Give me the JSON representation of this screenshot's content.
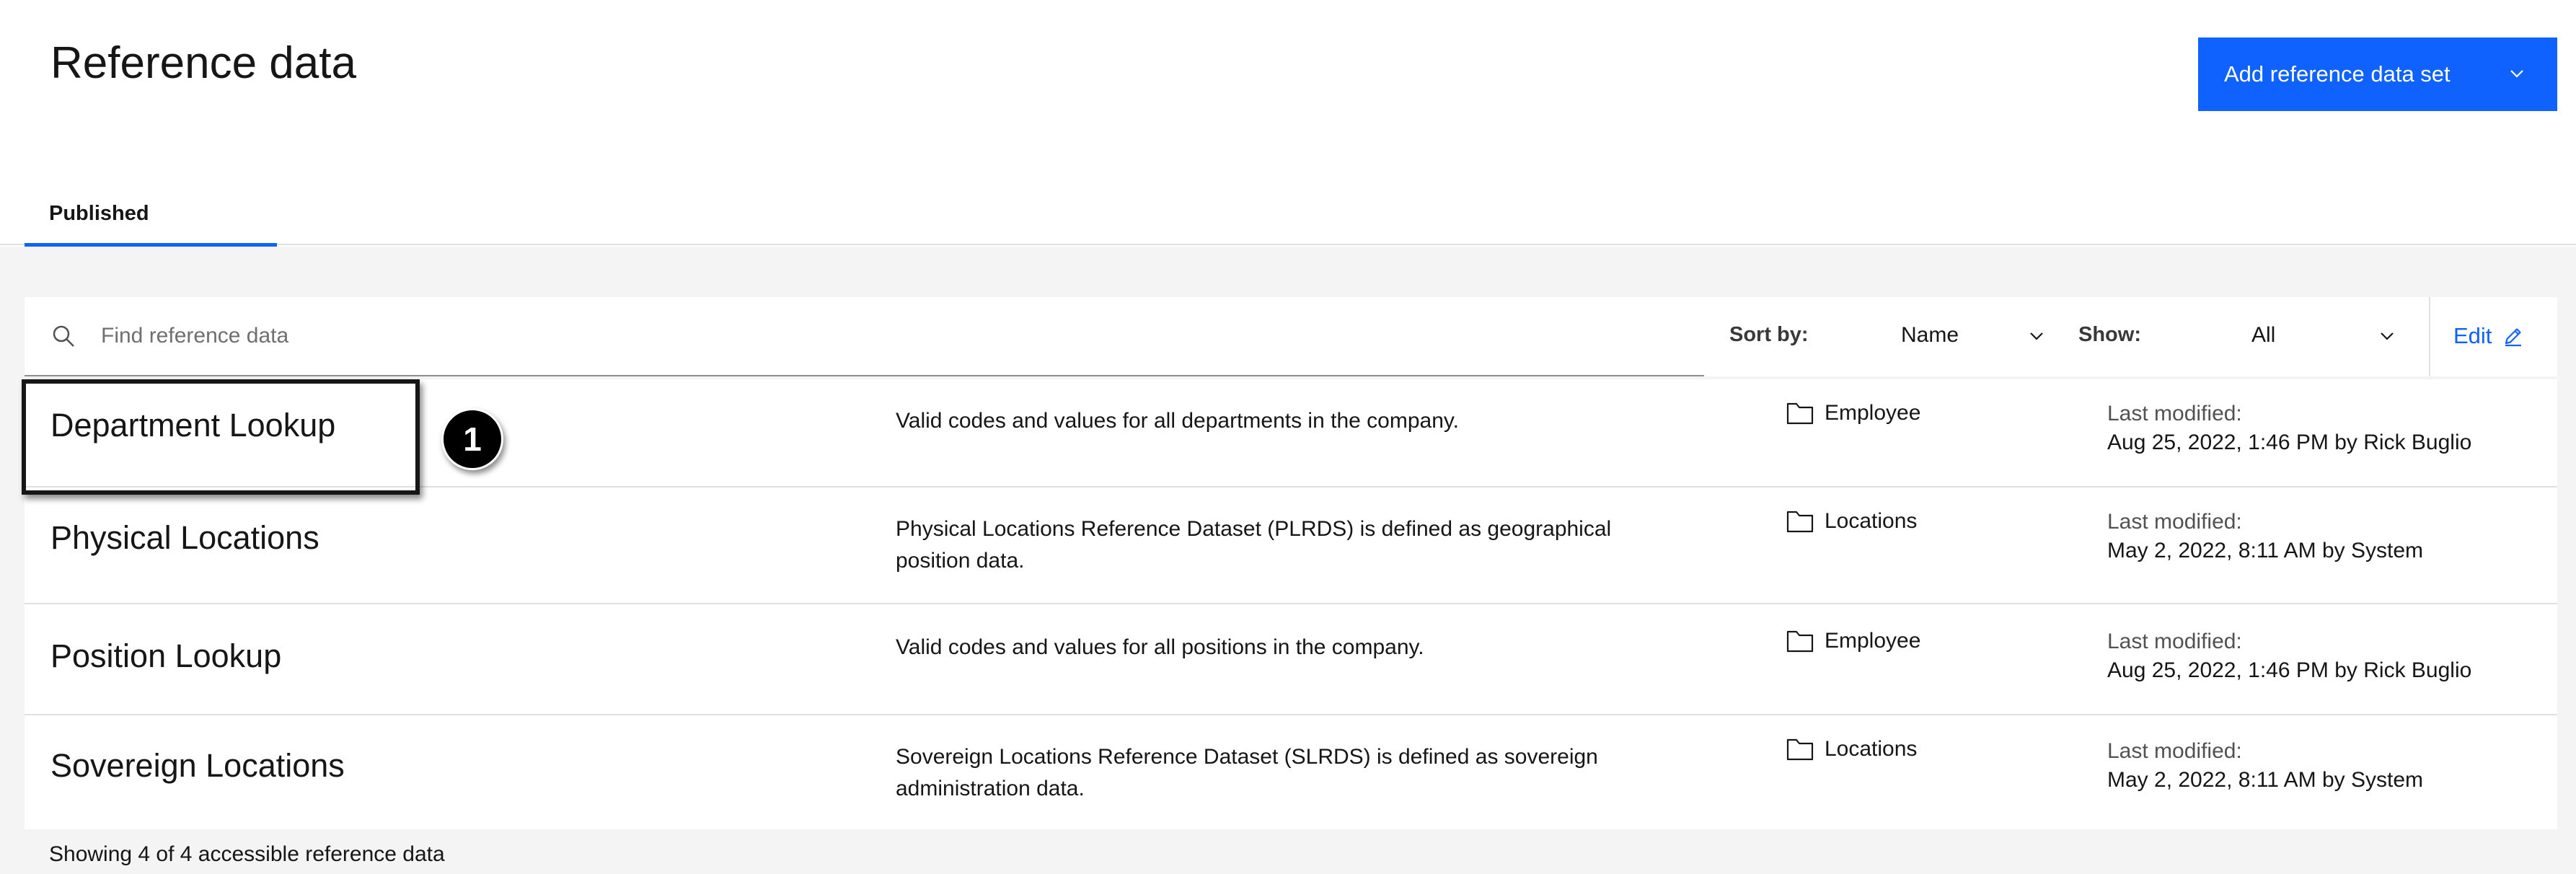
{
  "header": {
    "title": "Reference data",
    "add_button_label": "Add reference data set"
  },
  "tabs": [
    {
      "label": "Published",
      "selected": true
    }
  ],
  "toolbar": {
    "search_placeholder": "Find reference data",
    "search_value": "",
    "sort_label": "Sort by:",
    "sort_value": "Name",
    "show_label": "Show:",
    "show_value": "All",
    "edit_label": "Edit"
  },
  "rows": [
    {
      "name": "Department Lookup",
      "description": "Valid codes and values for all departments in the company.",
      "folder": "Employee",
      "modified_label": "Last modified:",
      "modified_value": "Aug 25, 2022, 1:46 PM by Rick Buglio"
    },
    {
      "name": "Physical Locations",
      "description": "Physical Locations Reference Dataset (PLRDS) is defined as geographical position data.",
      "folder": "Locations",
      "modified_label": "Last modified:",
      "modified_value": "May 2, 2022, 8:11 AM by System"
    },
    {
      "name": "Position Lookup",
      "description": "Valid codes and values for all positions in the company.",
      "folder": "Employee",
      "modified_label": "Last modified:",
      "modified_value": "Aug 25, 2022, 1:46 PM by Rick Buglio"
    },
    {
      "name": "Sovereign Locations",
      "description": "Sovereign Locations Reference Dataset (SLRDS) is defined as sovereign administration data.",
      "folder": "Locations",
      "modified_label": "Last modified:",
      "modified_value": "May 2, 2022, 8:11 AM by System"
    }
  ],
  "annotation": {
    "callout_number": "1"
  },
  "footer": {
    "count_text": "Showing 4 of 4 accessible reference data"
  },
  "colors": {
    "accent": "#0f62fe",
    "background": "#f4f4f4",
    "text": "#161616",
    "secondary_text": "#525252"
  },
  "icons": [
    "search-icon",
    "chevron-down-icon",
    "edit-pencil-icon",
    "folder-icon"
  ]
}
